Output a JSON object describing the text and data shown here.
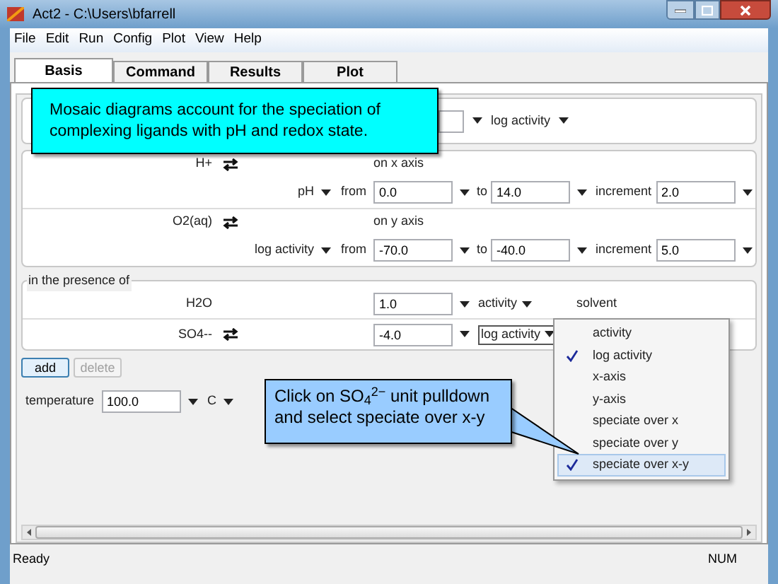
{
  "window": {
    "title": "Act2 - C:\\Users\\bfarrell"
  },
  "menu": [
    "File",
    "Edit",
    "Run",
    "Config",
    "Plot",
    "View",
    "Help"
  ],
  "tabs": [
    {
      "label": "Basis",
      "selected": true
    },
    {
      "label": "Command",
      "selected": false
    },
    {
      "label": "Results",
      "selected": false
    },
    {
      "label": "Plot",
      "selected": false
    }
  ],
  "top_row": {
    "unit": "log activity"
  },
  "axes": [
    {
      "name": "H+",
      "axis": "on x axis",
      "unit": "pH",
      "from_label": "from",
      "from": "0.0",
      "to_label": "to",
      "to": "14.0",
      "increment_label": "increment",
      "increment": "2.0"
    },
    {
      "name": "O2(aq)",
      "axis": "on y axis",
      "unit": "log activity",
      "from_label": "from",
      "from": "-70.0",
      "to_label": "to",
      "to": "-40.0",
      "increment_label": "increment",
      "increment": "5.0"
    }
  ],
  "presence": {
    "legend": "in the presence of",
    "rows": [
      {
        "name": "H2O",
        "swap": false,
        "value": "1.0",
        "unit": "activity",
        "open": false,
        "note": "solvent"
      },
      {
        "name": "SO4--",
        "swap": true,
        "value": "-4.0",
        "unit": "log activity",
        "open": true
      }
    ]
  },
  "buttons": [
    {
      "label": "add",
      "disabled": false
    },
    {
      "label": "delete",
      "disabled": true
    }
  ],
  "temperature": {
    "label": "temperature",
    "value": "100.0",
    "unit": "C"
  },
  "dropdown": [
    {
      "label": "activity",
      "checked": false,
      "selected": false
    },
    {
      "label": "log activity",
      "checked": true,
      "selected": false
    },
    {
      "label": "x-axis",
      "checked": false,
      "selected": false
    },
    {
      "label": "y-axis",
      "checked": false,
      "selected": false
    },
    {
      "label": "speciate over x",
      "checked": false,
      "selected": false
    },
    {
      "label": "speciate over y",
      "checked": false,
      "selected": false
    },
    {
      "label": "speciate over x-y",
      "checked": true,
      "selected": true
    }
  ],
  "callouts": [
    {
      "kind": "banner",
      "text": "Mosaic diagrams account for the speciation of complexing ligands with pH and redox state."
    },
    {
      "kind": "pointer",
      "text": "Click on SO$_{4}$$^{2−}$ unit pulldown and select speciate over x-y"
    }
  ],
  "status_bar": {
    "message": "Ready",
    "num": "NUM"
  }
}
